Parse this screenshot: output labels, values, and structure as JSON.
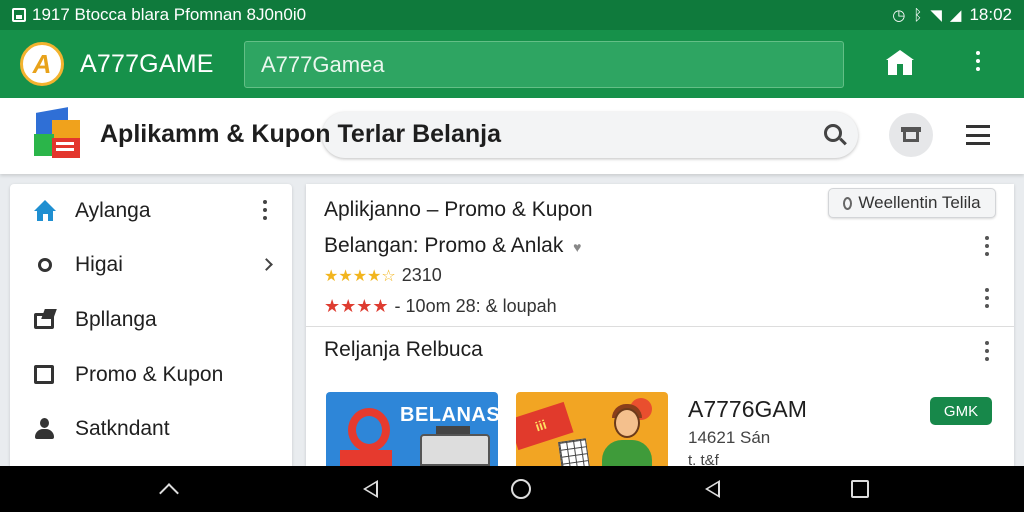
{
  "status_bar": {
    "left_text": "1917 Btocca blara Pfomnan 8J0n0i0",
    "icons": [
      "gallery-icon",
      "alarm-icon",
      "bluetooth-icon",
      "wifi-icon",
      "signal-icon"
    ],
    "time": "18:02"
  },
  "app_bar": {
    "logo_letter": "A",
    "title": "A777GAME",
    "search_value": "A777Gamea",
    "icons": [
      "store-icon",
      "more-vert-icon"
    ]
  },
  "sub_header": {
    "title": "Aplikamm & Kupon Terlar Belanja",
    "icons": [
      "search-icon",
      "store-icon",
      "menu-icon"
    ]
  },
  "drawer": {
    "items": [
      {
        "label": "Aylanga",
        "icon": "home-icon",
        "trail": "more"
      },
      {
        "label": "Higai",
        "icon": "gear-icon",
        "trail": "chevron"
      },
      {
        "label": "Bpllanga",
        "icon": "bag-icon",
        "trail": ""
      },
      {
        "label": "Promo & Kupon",
        "icon": "coupon-icon",
        "trail": ""
      },
      {
        "label": "Satkndant",
        "icon": "user-icon",
        "trail": ""
      }
    ]
  },
  "main": {
    "card_title": "Aplikjanno – Promo & Kupon",
    "chip_label": "Weellentin Telila",
    "subtitle": "Belangan: Promo & Anlak",
    "rating_1": "2310",
    "rating_2": "- 10om 28: & loupah",
    "section_title": "Reljanja Relbuca",
    "thumb1_text": "BELANAS",
    "thumb2_text": "iii",
    "app_name": "A7776GAM",
    "app_size": "14621 Sán",
    "app_extra": "t. t&f",
    "install_label": "GMK",
    "colors": {
      "primary": "#16914a",
      "accent": "#17884a",
      "star_yellow": "#f2b51e",
      "star_red": "#de3c30"
    }
  },
  "nav_bar": {
    "buttons": [
      "up-icon",
      "back-icon",
      "home-circle-icon",
      "back-icon",
      "recents-icon"
    ]
  }
}
